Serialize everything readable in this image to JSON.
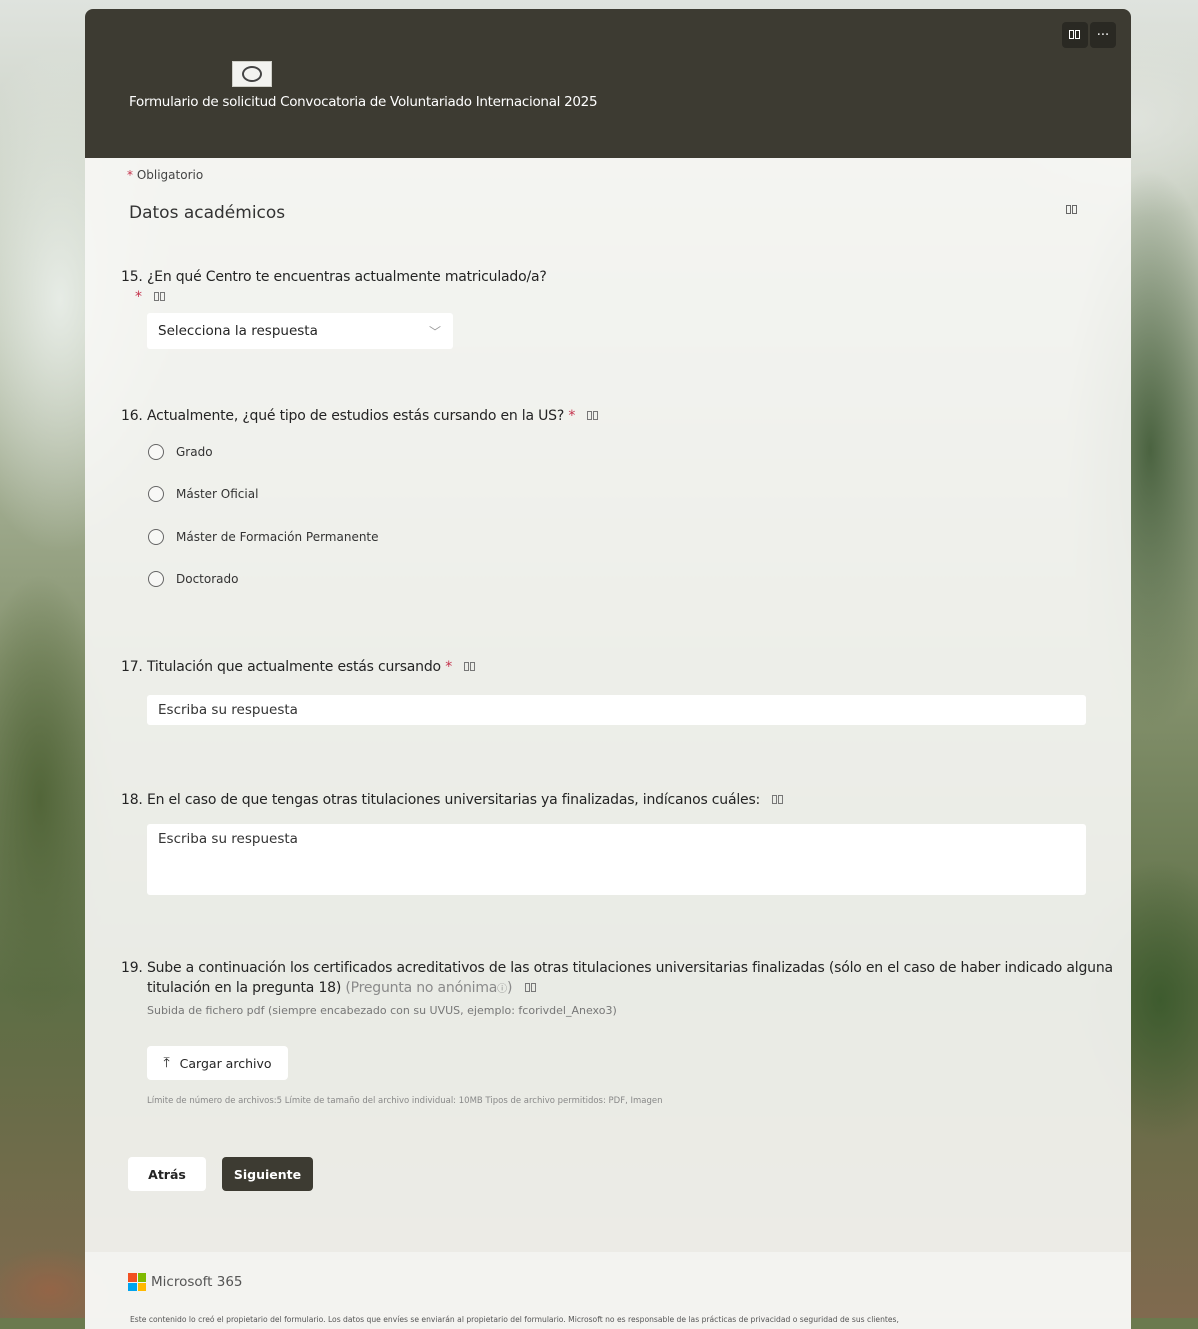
{
  "header": {
    "form_title": "Formulario de solicitud Convocatoria de Voluntariado Internacional 2025",
    "more_label": "···",
    "immersive_reader_icon": "book-reader-icon"
  },
  "required_note": {
    "asterisk": "*",
    "text": "Obligatorio"
  },
  "section": {
    "title": "Datos académicos"
  },
  "questions": [
    {
      "number": "15.",
      "title": "¿En qué Centro te encuentras actualmente matriculado/a?",
      "required": "*",
      "type": "select",
      "placeholder": "Selecciona la respuesta"
    },
    {
      "number": "16.",
      "title": "Actualmente, ¿qué tipo de estudios estás cursando en la US?",
      "required": "*",
      "type": "radio",
      "options": [
        "Grado",
        "Máster Oficial",
        "Máster de Formación Permanente",
        "Doctorado"
      ]
    },
    {
      "number": "17.",
      "title": "Titulación que actualmente estás cursando",
      "required": "*",
      "type": "text",
      "placeholder": "Escriba su respuesta"
    },
    {
      "number": "18.",
      "title": "En el caso de que tengas otras titulaciones universitarias ya finalizadas, indícanos cuáles:",
      "type": "textarea",
      "placeholder": "Escriba su respuesta"
    },
    {
      "number": "19.",
      "title_line1": "Sube a continuación los certificados acreditativos de las otras titulaciones universitarias finalizadas (sólo en el caso de haber indicado alguna",
      "title_line2": "titulación en la pregunta 18)",
      "non_anonymous": "(Pregunta no anónima",
      "subtitle": "Subida de fichero pdf (siempre encabezado con su UVUS, ejemplo: fcorivdel_Anexo3)",
      "type": "file",
      "upload_label": "Cargar archivo",
      "limits": "Límite de número de archivos:5   Límite de tamaño del archivo individual: 10MB   Tipos de archivo permitidos: PDF, Imagen"
    }
  ],
  "nav": {
    "back_label": "Atrás",
    "next_label": "Siguiente"
  },
  "footer": {
    "brand": "Microsoft 365",
    "disclaimer": "Este contenido lo creó el propietario del formulario. Los datos que envíes se enviarán al propietario del formulario. Microsoft no es responsable de las prácticas de privacidad o seguridad de sus clientes,"
  },
  "colors": {
    "header_bg": "#3d3b32",
    "required_red": "#c4314b",
    "next_button_bg": "#3d3b32"
  }
}
